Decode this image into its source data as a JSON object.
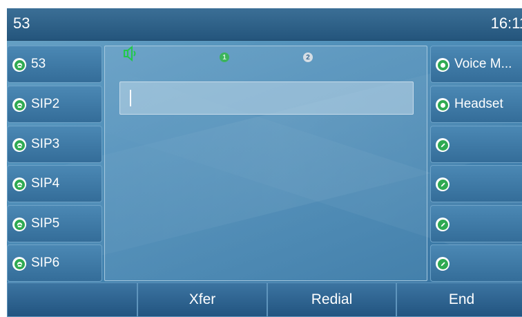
{
  "header": {
    "account": "53",
    "time": "16:11"
  },
  "left_keys": [
    {
      "label": "53",
      "icon": "phone-icon"
    },
    {
      "label": "SIP2",
      "icon": "phone-icon"
    },
    {
      "label": "SIP3",
      "icon": "phone-icon"
    },
    {
      "label": "SIP4",
      "icon": "phone-icon"
    },
    {
      "label": "SIP5",
      "icon": "phone-icon"
    },
    {
      "label": "SIP6",
      "icon": "phone-icon"
    }
  ],
  "right_keys": [
    {
      "label": "Voice M...",
      "icon": "radio-icon"
    },
    {
      "label": "Headset",
      "icon": "radio-icon"
    },
    {
      "label": "",
      "icon": "edit-icon"
    },
    {
      "label": "",
      "icon": "edit-icon"
    },
    {
      "label": "",
      "icon": "edit-icon"
    },
    {
      "label": "",
      "icon": "edit-icon"
    }
  ],
  "dial": {
    "indicator_1": "1",
    "indicator_2": "2",
    "input_value": ""
  },
  "softkeys": [
    "",
    "Xfer",
    "Redial",
    "End"
  ],
  "colors": {
    "accent_green": "#2faa52",
    "speaker_green": "#22c84a"
  }
}
